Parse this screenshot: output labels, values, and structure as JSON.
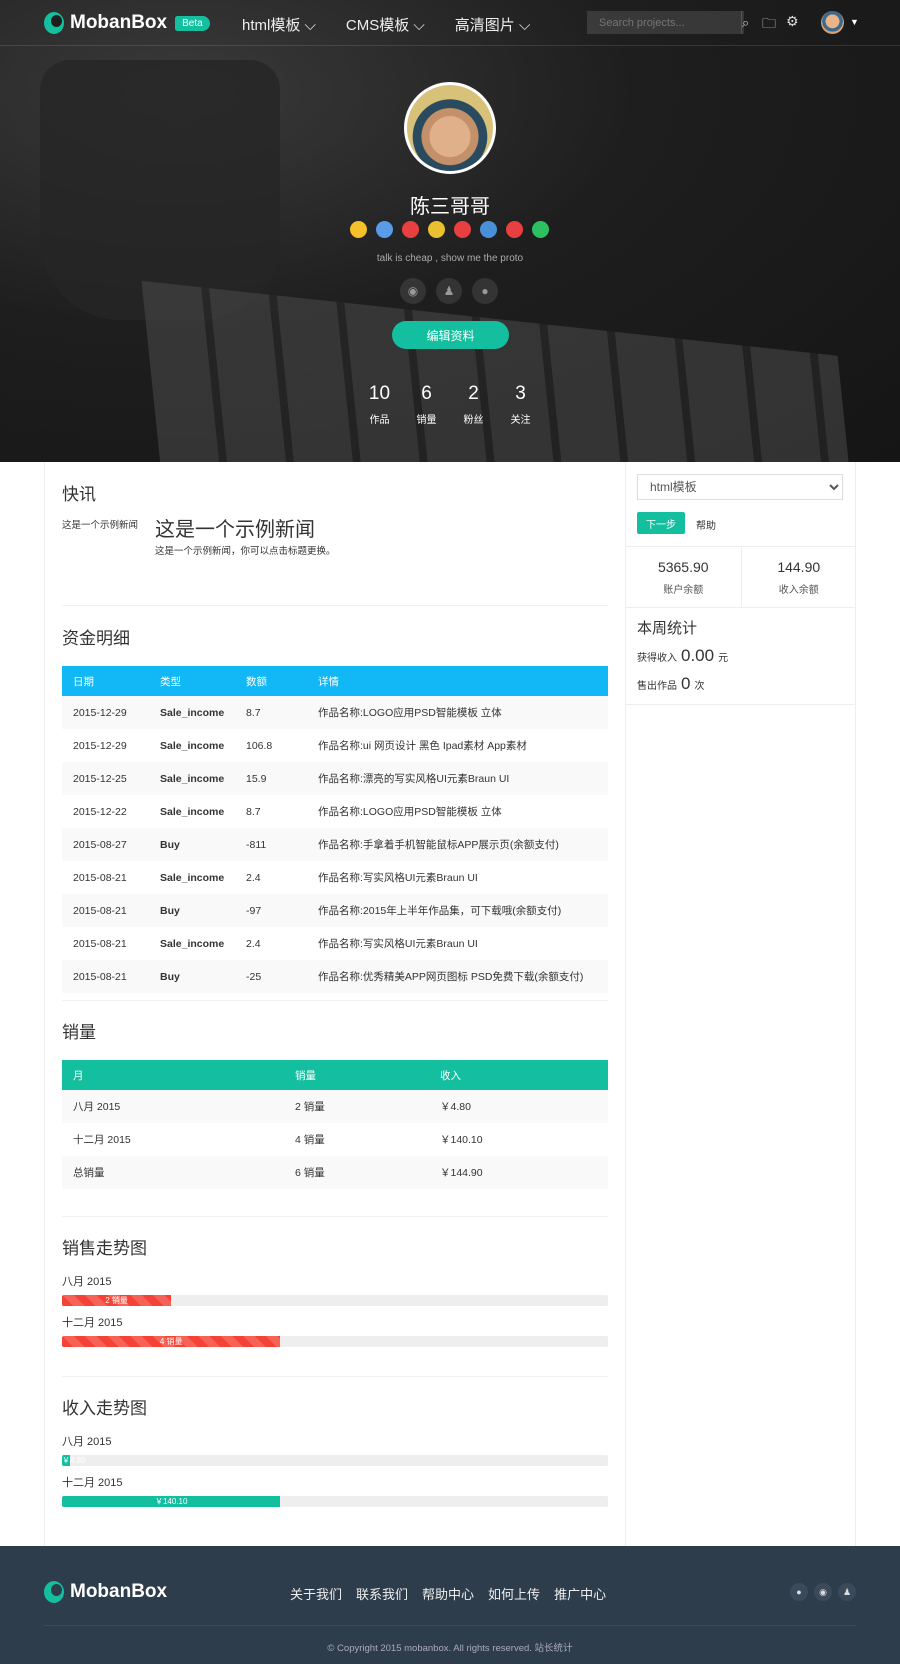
{
  "nav": {
    "brand": "MobanBox",
    "beta": "Beta",
    "menu": [
      "html模板",
      "CMS模板",
      "高清图片"
    ],
    "search_placeholder": "Search projects..."
  },
  "profile": {
    "name": "陈三哥哥",
    "motto": "talk is cheap , show me the proto",
    "edit_label": "编辑资料",
    "badge_colors": [
      "#f5c02c",
      "#5a9be8",
      "#e84040",
      "#e8c030",
      "#e84040",
      "#4a90d9",
      "#e84040",
      "#2ec060"
    ],
    "stats": [
      {
        "value": "10",
        "label": "作品"
      },
      {
        "value": "6",
        "label": "销量"
      },
      {
        "value": "2",
        "label": "粉丝"
      },
      {
        "value": "3",
        "label": "关注"
      }
    ]
  },
  "news": {
    "title": "快讯",
    "side_label": "这是一个示例新闻",
    "headline": "这是一个示例新闻",
    "desc": "这是一个示例新闻，你可以点击标题更换。"
  },
  "funds": {
    "title": "资金明细",
    "header_color": "#12b7f5",
    "columns": [
      "日期",
      "类型",
      "数额",
      "详情"
    ],
    "rows": [
      [
        "2015-12-29",
        "Sale_income",
        "8.7",
        "作品名称:LOGO应用PSD智能模板 立体"
      ],
      [
        "2015-12-29",
        "Sale_income",
        "106.8",
        "作品名称:ui 网页设计 黑色 Ipad素材 App素材"
      ],
      [
        "2015-12-25",
        "Sale_income",
        "15.9",
        "作品名称:漂亮的写实风格UI元素Braun UI"
      ],
      [
        "2015-12-22",
        "Sale_income",
        "8.7",
        "作品名称:LOGO应用PSD智能模板 立体"
      ],
      [
        "2015-08-27",
        "Buy",
        "-811",
        "作品名称:手拿着手机智能鼠标APP展示页(余额支付)"
      ],
      [
        "2015-08-21",
        "Sale_income",
        "2.4",
        "作品名称:写实风格UI元素Braun UI"
      ],
      [
        "2015-08-21",
        "Buy",
        "-97",
        "作品名称:2015年上半年作品集，可下载哦(余额支付)"
      ],
      [
        "2015-08-21",
        "Sale_income",
        "2.4",
        "作品名称:写实风格UI元素Braun UI"
      ],
      [
        "2015-08-21",
        "Buy",
        "-25",
        "作品名称:优秀精美APP网页图标 PSD免费下载(余额支付)"
      ]
    ]
  },
  "sales": {
    "title": "销量",
    "header_color": "#14bfa0",
    "columns": [
      "月",
      "销量",
      "收入"
    ],
    "rows": [
      [
        "八月 2015",
        "2 销量",
        "￥4.80"
      ],
      [
        "十二月 2015",
        "4 销量",
        "￥140.10"
      ],
      [
        "总销量",
        "6 销量",
        "￥144.90"
      ]
    ]
  },
  "sales_trend": {
    "title": "销售走势图",
    "items": [
      {
        "label": "八月 2015",
        "text": "2 销量",
        "percent": 20
      },
      {
        "label": "十二月 2015",
        "text": "4 销量",
        "percent": 40
      }
    ]
  },
  "income_trend": {
    "title": "收入走势图",
    "items": [
      {
        "label": "八月 2015",
        "text": "￥4.80",
        "percent": 1.4
      },
      {
        "label": "十二月 2015",
        "text": "￥140.10",
        "percent": 40
      }
    ]
  },
  "sidebar": {
    "select_value": "html模板",
    "next_label": "下一步",
    "help_label": "帮助",
    "account_balance": "5365.90",
    "account_label": "账户余额",
    "income_balance": "144.90",
    "income_label": "收入余额",
    "week_title": "本周统计",
    "earned_label": "获得收入",
    "earned_value": "0.00",
    "earned_unit": "元",
    "sold_label": "售出作品",
    "sold_value": "0",
    "sold_unit": "次"
  },
  "footer": {
    "brand": "MobanBox",
    "links": [
      "关于我们",
      "联系我们",
      "帮助中心",
      "如何上传",
      "推广中心"
    ],
    "copyright": "© Copyright 2015 mobanbox. All rights reserved.   站长统计"
  }
}
